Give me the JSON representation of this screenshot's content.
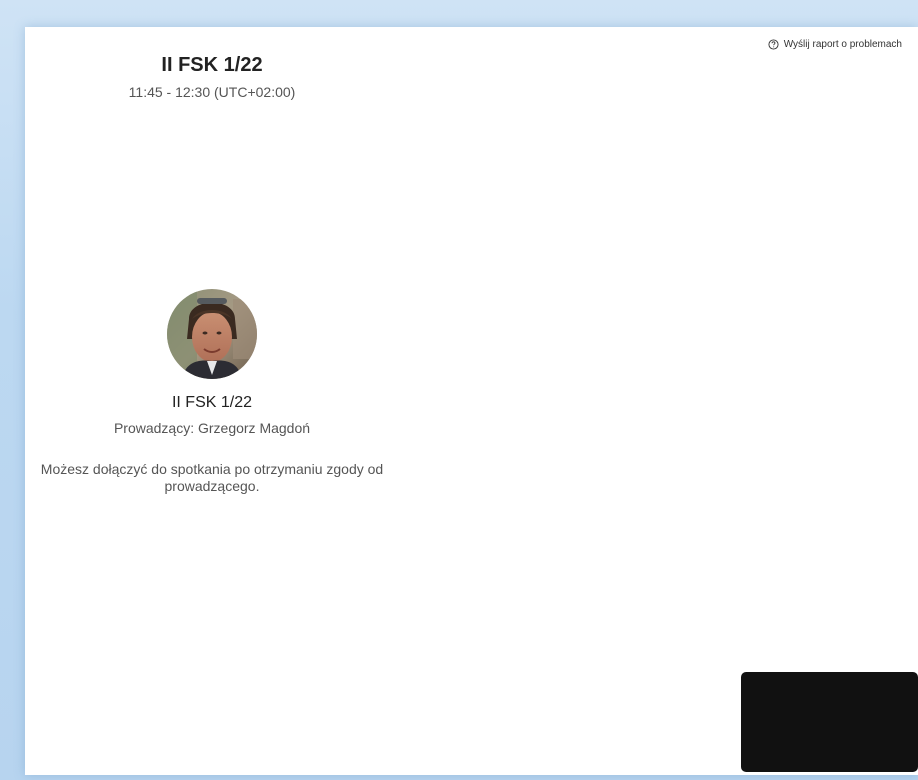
{
  "header": {
    "report_link_label": "Wyślij raport o problemach",
    "report_icon": "help-circle-icon"
  },
  "meeting": {
    "title": "II FSK 1/22",
    "time": "11:45 - 12:30 (UTC+02:00)"
  },
  "host": {
    "avatar": "host-avatar-photo",
    "title": "II FSK 1/22",
    "name": "Prowadzący: Grzegorz Magdoń"
  },
  "waiting": {
    "message": "Możesz dołączyć do spotkania po otrzymaniu zgody od prowadzącego."
  },
  "self_preview": {
    "color": "#111111"
  }
}
